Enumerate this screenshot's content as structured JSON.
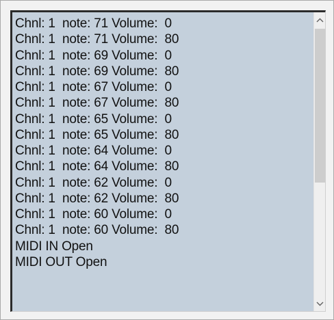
{
  "log": {
    "lines": [
      "Chnl: 1  note: 71 Volume:  0",
      "Chnl: 1  note: 71 Volume:  80",
      "Chnl: 1  note: 69 Volume:  0",
      "Chnl: 1  note: 69 Volume:  80",
      "Chnl: 1  note: 67 Volume:  0",
      "Chnl: 1  note: 67 Volume:  80",
      "Chnl: 1  note: 65 Volume:  0",
      "Chnl: 1  note: 65 Volume:  80",
      "Chnl: 1  note: 64 Volume:  0",
      "Chnl: 1  note: 64 Volume:  80",
      "Chnl: 1  note: 62 Volume:  0",
      "Chnl: 1  note: 62 Volume:  80",
      "Chnl: 1  note: 60 Volume:  0",
      "Chnl: 1  note: 60 Volume:  80",
      "MIDI IN Open",
      "MIDI OUT Open"
    ]
  },
  "scrollbar": {
    "up_icon": "chevron-up-icon",
    "down_icon": "chevron-down-icon"
  },
  "colors": {
    "list_background": "#c4d0dc",
    "scrollbar_track": "#efefef",
    "scrollbar_thumb": "#cdcdcd"
  }
}
